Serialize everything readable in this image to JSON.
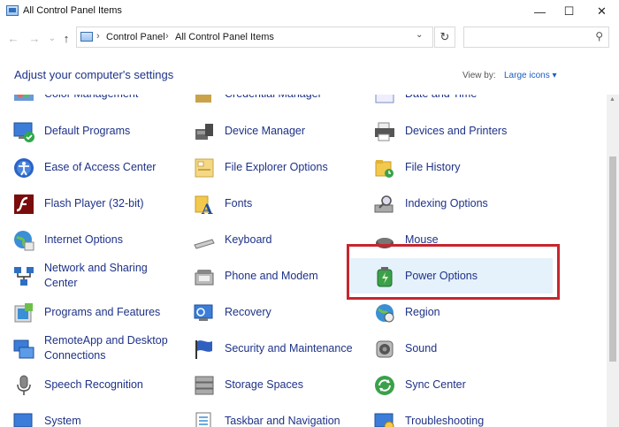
{
  "window": {
    "title": "All Control Panel Items",
    "minimize": "—",
    "maximize": "☐",
    "close": "✕"
  },
  "nav": {
    "back": "←",
    "forward": "→",
    "recent": "⌄",
    "up": "↑",
    "refresh": "↻",
    "dropdown": "⌄",
    "search_icon": "⚲"
  },
  "breadcrumb": {
    "separator": "›",
    "items": [
      "Control Panel",
      "All Control Panel Items"
    ]
  },
  "search": {
    "placeholder": ""
  },
  "header": {
    "title": "Adjust your computer's settings",
    "view_by_label": "View by:",
    "view_by_value": "Large icons ▾"
  },
  "colors": {
    "link": "#1e3287",
    "highlight": "#e5f1fb",
    "annotation": "#c7262e"
  },
  "items": [
    {
      "label": "Color Management",
      "icon": "color-management-icon"
    },
    {
      "label": "Credential Manager",
      "icon": "credential-manager-icon"
    },
    {
      "label": "Date and Time",
      "icon": "date-time-icon"
    },
    {
      "label": "Default Programs",
      "icon": "default-programs-icon"
    },
    {
      "label": "Device Manager",
      "icon": "device-manager-icon"
    },
    {
      "label": "Devices and Printers",
      "icon": "printer-icon"
    },
    {
      "label": "Ease of Access Center",
      "icon": "ease-of-access-icon"
    },
    {
      "label": "File Explorer Options",
      "icon": "folder-options-icon"
    },
    {
      "label": "File History",
      "icon": "file-history-icon"
    },
    {
      "label": "Flash Player (32-bit)",
      "icon": "flash-icon"
    },
    {
      "label": "Fonts",
      "icon": "fonts-icon"
    },
    {
      "label": "Indexing Options",
      "icon": "indexing-icon"
    },
    {
      "label": "Internet Options",
      "icon": "internet-options-icon"
    },
    {
      "label": "Keyboard",
      "icon": "keyboard-icon"
    },
    {
      "label": "Mouse",
      "icon": "mouse-icon"
    },
    {
      "label": "Network and Sharing Center",
      "icon": "network-icon"
    },
    {
      "label": "Phone and Modem",
      "icon": "phone-icon"
    },
    {
      "label": "Power Options",
      "icon": "power-options-icon"
    },
    {
      "label": "Programs and Features",
      "icon": "programs-icon"
    },
    {
      "label": "Recovery",
      "icon": "recovery-icon"
    },
    {
      "label": "Region",
      "icon": "region-icon"
    },
    {
      "label": "RemoteApp and Desktop Connections",
      "icon": "remoteapp-icon"
    },
    {
      "label": "Security and Maintenance",
      "icon": "flag-icon"
    },
    {
      "label": "Sound",
      "icon": "speaker-icon"
    },
    {
      "label": "Speech Recognition",
      "icon": "microphone-icon"
    },
    {
      "label": "Storage Spaces",
      "icon": "storage-icon"
    },
    {
      "label": "Sync Center",
      "icon": "sync-icon"
    },
    {
      "label": "System",
      "icon": "system-icon"
    },
    {
      "label": "Taskbar and Navigation",
      "icon": "taskbar-icon"
    },
    {
      "label": "Troubleshooting",
      "icon": "troubleshoot-icon"
    }
  ]
}
